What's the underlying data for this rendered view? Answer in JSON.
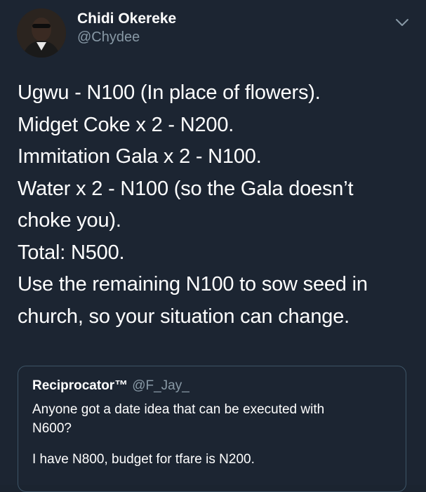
{
  "tweet": {
    "author": {
      "name": "Chidi Okereke",
      "handle": "@Chydee"
    },
    "body_lines": [
      "Ugwu - N100 (In place of flowers).",
      "Midget Coke x 2 - N200.",
      "Immitation Gala x 2 - N100.",
      "Water x 2 - N100 (so the Gala doesn’t",
      "choke you).",
      "Total: N500.",
      "Use the remaining N100 to sow seed in",
      "church, so your situation can change."
    ],
    "quoted": {
      "name": "Reciprocator™",
      "handle": "@F_Jay_",
      "lines": [
        "Anyone got a date idea that can be executed with",
        "N600?",
        "I have N800, budget for tfare is N200."
      ]
    }
  },
  "icons": {
    "menu": "chevron-down-icon",
    "avatar": "avatar-photo"
  },
  "colors": {
    "background": "#1c2532",
    "secondary_text": "#8899a6",
    "quote_border": "#3d5466"
  }
}
